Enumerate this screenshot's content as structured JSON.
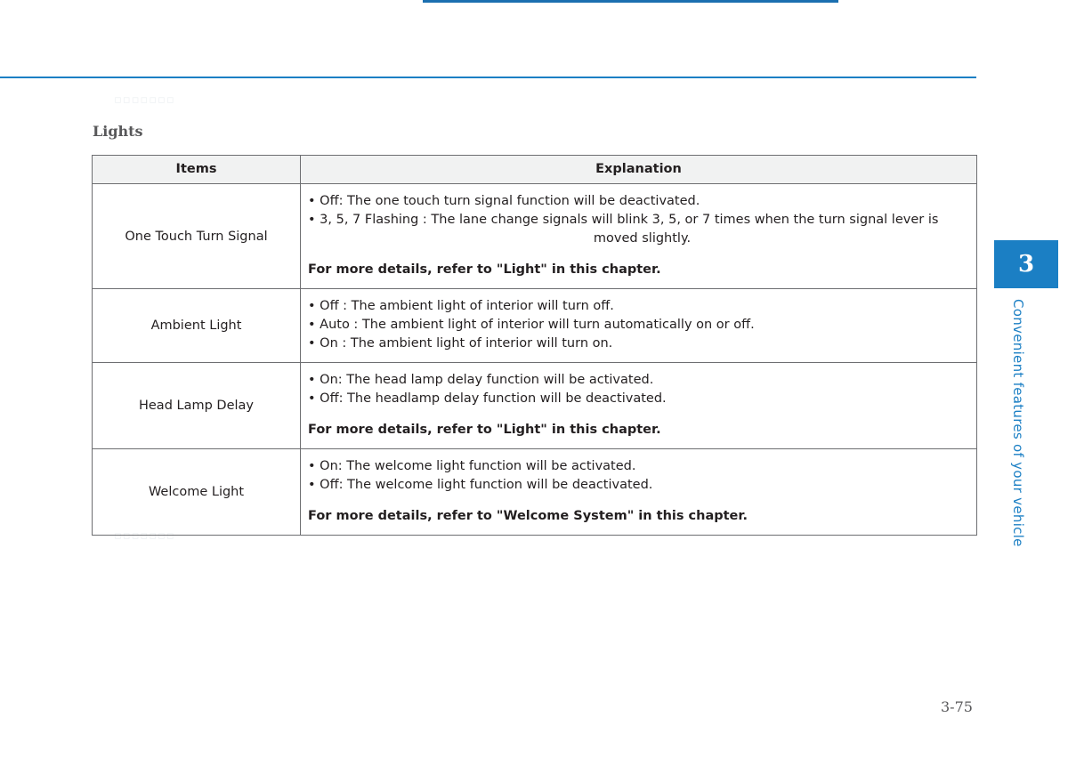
{
  "document": {
    "section_title": "Lights",
    "page_number": "3-75",
    "chapter_number": "3",
    "chapter_label": "Convenient features of your vehicle"
  },
  "table": {
    "headers": [
      "Items",
      "Explanation"
    ],
    "rows": [
      {
        "item": "One Touch Turn Signal",
        "bullets": [
          "• Off: The one touch turn signal function will be deactivated.",
          "• 3, 5, 7 Flashing : The lane change signals will blink 3, 5, or 7 times when the turn signal lever is"
        ],
        "bullet2_continuation": "moved slightly.",
        "note": "For more details, refer to \"Light\" in this chapter."
      },
      {
        "item": "Ambient Light",
        "bullets": [
          "• Off : The ambient light of interior will turn off.",
          "• Auto : The ambient light of interior will turn automatically on or off.",
          "• On : The ambient light of interior will turn on."
        ],
        "note": ""
      },
      {
        "item": "Head Lamp Delay",
        "bullets": [
          "• On: The head lamp delay function will be activated.",
          "• Off: The headlamp delay function will be deactivated."
        ],
        "note": "For more details, refer to \"Light\" in this chapter."
      },
      {
        "item": "Welcome Light",
        "bullets": [
          "• On: The welcome light function will be activated.",
          "• Off: The welcome light function will be deactivated."
        ],
        "note": "For more details, refer to \"Welcome System\" in this chapter."
      }
    ]
  },
  "colors": {
    "accent": "#1b7fc4",
    "rule": "#1b6fb0",
    "border": "#6d6e71",
    "header_fill": "#f1f2f2",
    "title_text": "#58585a"
  }
}
